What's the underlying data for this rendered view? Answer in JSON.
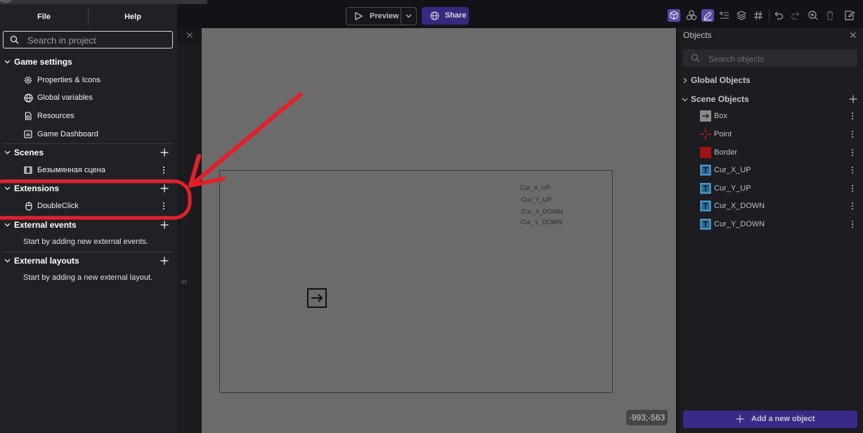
{
  "project_manager": {
    "menu": {
      "file": "File",
      "help": "Help"
    },
    "search": {
      "placeholder": "Search in project",
      "value": ""
    },
    "game_settings": {
      "title": "Game settings",
      "items": [
        {
          "label": "Properties & Icons",
          "icon": "gear-icon"
        },
        {
          "label": "Global variables",
          "icon": "global-variables-icon"
        },
        {
          "label": "Resources",
          "icon": "resources-icon"
        },
        {
          "label": "Game Dashboard",
          "icon": "dashboard-icon"
        }
      ]
    },
    "scenes": {
      "title": "Scenes",
      "items": [
        {
          "label": "Безымянная сцена",
          "icon": "scene-icon"
        }
      ]
    },
    "extensions": {
      "title": "Extensions",
      "items": [
        {
          "label": "DoubleClick",
          "icon": "mouse-icon"
        }
      ]
    },
    "external_events": {
      "title": "External events",
      "empty_text": "Start by adding new external events."
    },
    "external_layouts": {
      "title": "External layouts",
      "empty_text": "Start by adding a new external layout."
    }
  },
  "toolbar": {
    "preview_label": "Preview",
    "share_label": "Share",
    "icons": [
      "objects-panel-icon",
      "object-groups-icon",
      "properties-panel-icon",
      "instances-list-icon",
      "layers-icon",
      "grid-icon",
      "undo-icon",
      "redo-icon",
      "zoom-icon",
      "delete-icon",
      "scene-properties-icon"
    ]
  },
  "editor": {
    "hidden_tab_text": "in"
  },
  "scene": {
    "text_objects": [
      "Cur_X_UP",
      "Cur_Y_UP",
      "Cur_X_DOWN",
      "Cur_Y_DOWN"
    ],
    "cursor_position": "-993;-563"
  },
  "objects_panel": {
    "title": "Objects",
    "search_placeholder": "Search objects",
    "global_objects": "Global Objects",
    "scene_objects": "Scene Objects",
    "items": [
      {
        "name": "Box",
        "icon": "sprite-icon"
      },
      {
        "name": "Point",
        "icon": "point-icon"
      },
      {
        "name": "Border",
        "icon": "border-sprite-icon"
      },
      {
        "name": "Cur_X_UP",
        "icon": "text-object-icon"
      },
      {
        "name": "Cur_Y_UP",
        "icon": "text-object-icon"
      },
      {
        "name": "Cur_X_DOWN",
        "icon": "text-object-icon"
      },
      {
        "name": "Cur_Y_DOWN",
        "icon": "text-object-icon"
      }
    ],
    "add_button": "Add a new object"
  },
  "colors": {
    "accent": "#5a48a8",
    "annotation": "#e3202a",
    "canvas": "#6b6b6b"
  }
}
